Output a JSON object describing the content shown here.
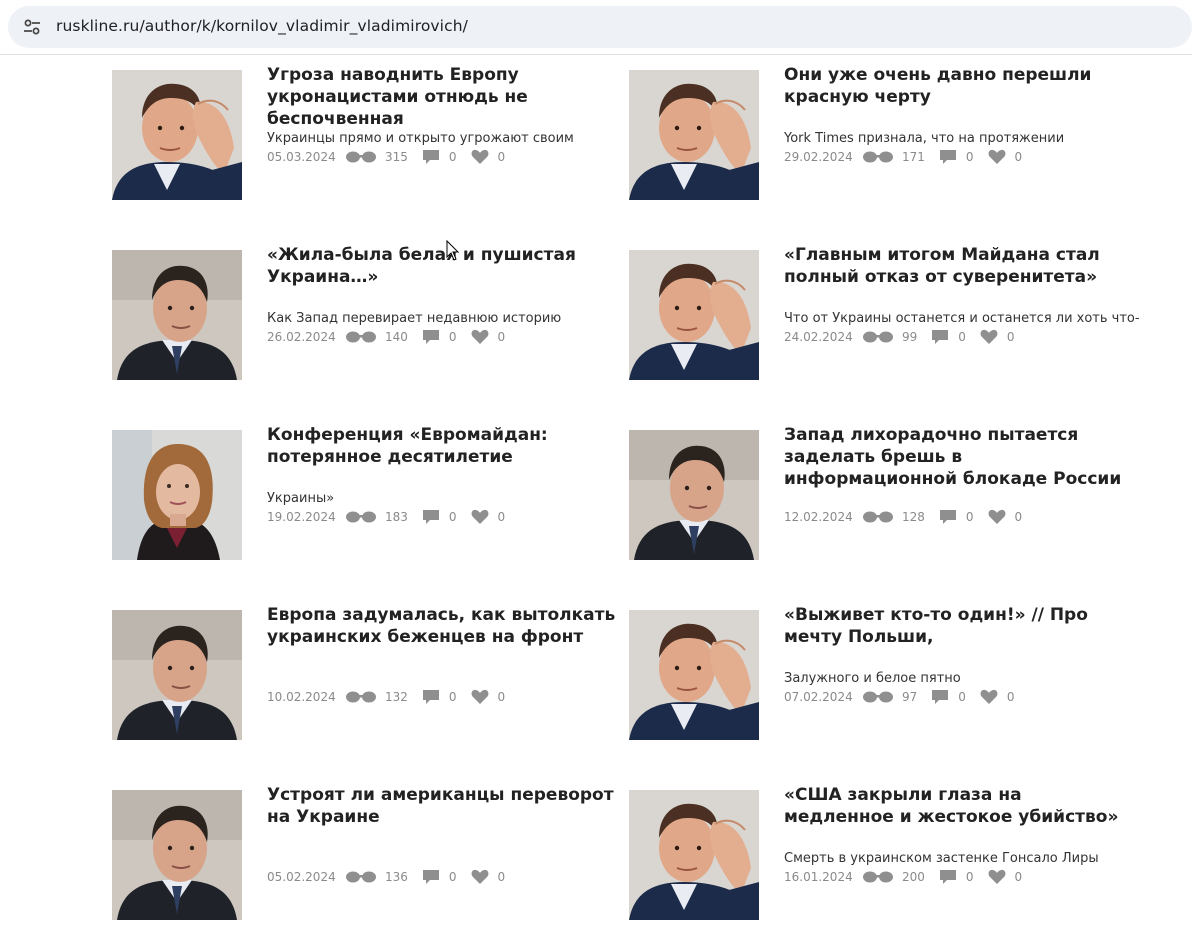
{
  "browser": {
    "url": "ruskline.ru/author/k/kornilov_vladimir_vladimirovich/",
    "site_info_icon": "tune-icon"
  },
  "articles": [
    {
      "title": "Угроза наводнить Европу укронацистами отнюдь не беспочвенная",
      "lead": "Украинцы прямо и открыто угрожают своим",
      "date": "05.03.2024",
      "views": "315",
      "comments": "0",
      "likes": "0",
      "photo": "hand-on-forehead"
    },
    {
      "title": "Они уже очень давно перешли красную черту",
      "lead": "York Times признала, что на протяжении",
      "date": "29.02.2024",
      "views": "171",
      "comments": "0",
      "likes": "0",
      "photo": "hand-on-forehead"
    },
    {
      "title": "«Жила-была белая и пушистая Украина…»",
      "lead": "Как Запад перевирает недавнюю историю",
      "date": "26.02.2024",
      "views": "140",
      "comments": "0",
      "likes": "0",
      "photo": "suit-tie"
    },
    {
      "title": "«Главным итогом Майдана стал полный отказ от суверенитета»",
      "lead": "Что от Украины останется и останется ли хоть что-",
      "date": "24.02.2024",
      "views": "99",
      "comments": "0",
      "likes": "0",
      "photo": "hand-on-forehead"
    },
    {
      "title": "Конференция «Евромайдан: потерянное десятилетие",
      "lead": "Украины»",
      "date": "19.02.2024",
      "views": "183",
      "comments": "0",
      "likes": "0",
      "photo": "woman"
    },
    {
      "title": "Запад лихорадочно пытается заделать брешь в информационной блокаде России",
      "lead": "",
      "date": "12.02.2024",
      "views": "128",
      "comments": "0",
      "likes": "0",
      "photo": "suit-tie"
    },
    {
      "title": "Европа задумалась, как вытолкать украинских беженцев на фронт",
      "lead": "",
      "date": "10.02.2024",
      "views": "132",
      "comments": "0",
      "likes": "0",
      "photo": "suit-tie"
    },
    {
      "title": "«Выживет кто-то один!» // Про мечту Польши,",
      "lead": "Залужного и белое пятно",
      "date": "07.02.2024",
      "views": "97",
      "comments": "0",
      "likes": "0",
      "photo": "hand-on-forehead"
    },
    {
      "title": "Устроят ли американцы переворот на Украине",
      "lead": "",
      "date": "05.02.2024",
      "views": "136",
      "comments": "0",
      "likes": "0",
      "photo": "suit-tie"
    },
    {
      "title": "«США закрыли глаза на медленное и жестокое убийство»",
      "lead": "Смерть в украинском застенке Гонсало Лиры",
      "date": "16.01.2024",
      "views": "200",
      "comments": "0",
      "likes": "0",
      "photo": "hand-on-forehead"
    }
  ],
  "icons": {
    "views": "glasses-icon",
    "comments": "comment-icon",
    "likes": "heart-icon"
  },
  "colors": {
    "title": "#222222",
    "meta": "#8a8a8a",
    "icon": "#8f8f8f",
    "address_bar": "#eef1f6"
  }
}
